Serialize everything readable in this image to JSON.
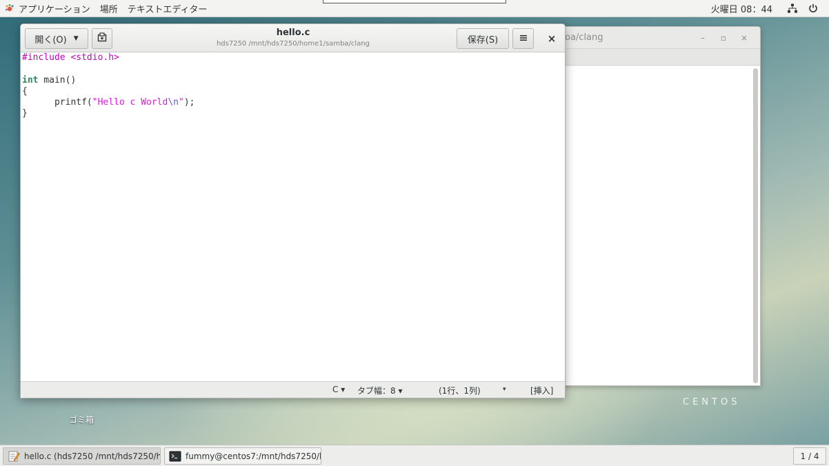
{
  "topbar": {
    "applications": "アプリケーション",
    "places": "場所",
    "active_app": "テキストエディター",
    "clock": "火曜日 08：44"
  },
  "background_window": {
    "title": "oa/clang",
    "minimize": "–",
    "maximize": "▫",
    "close": "×"
  },
  "gedit": {
    "open_label": "開く(O)",
    "save_label": "保存(S)",
    "close_label": "×",
    "filename": "hello.c",
    "filepath": "hds7250 /mnt/hds7250/home1/samba/clang",
    "code": {
      "l1": "#include <stdio.h>",
      "l3_kw": "int",
      "l3_rest": " main()",
      "l4": "{",
      "l5_pre": "      printf(",
      "l5_str": "\"Hello c World",
      "l5_esc": "\\n",
      "l5_q": "\"",
      "l5_post": ");",
      "l6": "}"
    },
    "status": {
      "language": "C ▾",
      "tab_width": "タブ幅：8 ▾",
      "position": "(1行、1列)",
      "dropdown": "▾",
      "mode": "[挿入]"
    }
  },
  "desktop": {
    "trash_label": "ゴミ箱",
    "centos_wordmark": "CENTOS"
  },
  "taskbar": {
    "task1": "hello.c (hds7250 /mnt/hds7250/ho···",
    "task2": "fummy@centos7:/mnt/hds7250/ho···",
    "pager": "1 / 4"
  },
  "icons": {
    "app_menu": "gnome-foot-icon",
    "network": "network-icon",
    "power": "power-icon",
    "new_tab": "new-document-tab-icon",
    "hamburger": "hamburger-menu-icon",
    "gedit": "text-editor-icon",
    "terminal": "terminal-icon"
  },
  "colors": {
    "preprocessor": "#c000c0",
    "keyword": "#2e8b57",
    "string": "#e01adb",
    "escape": "#6a5acd"
  }
}
